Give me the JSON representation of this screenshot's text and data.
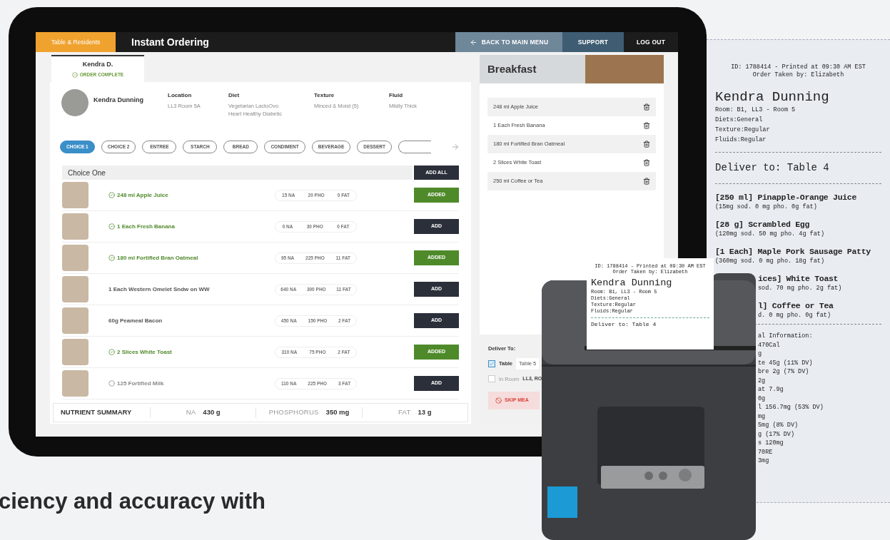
{
  "app": {
    "section_tab": "Table & Residents",
    "title": "Instant Ordering",
    "nav": [
      {
        "label": "BACK TO MAIN MENU",
        "kind": "back"
      },
      {
        "label": "SUPPORT",
        "kind": "support"
      },
      {
        "label": "LOG OUT",
        "kind": "logout"
      }
    ]
  },
  "resident_tab": {
    "name": "Kendra D.",
    "status": "ORDER COMPLETE"
  },
  "resident": {
    "name": "Kendra Dunning",
    "fields": [
      {
        "label": "Location",
        "values": [
          "LL3 Room 5A"
        ]
      },
      {
        "label": "Diet",
        "values": [
          "Vegetarian LactoOvo",
          "Heart Healthy Diabetic"
        ]
      },
      {
        "label": "Texture",
        "values": [
          "Minced & Moist (5)"
        ]
      },
      {
        "label": "Fluid",
        "values": [
          "Mildly Thick"
        ]
      }
    ]
  },
  "chips": [
    {
      "label": "CHOICE 1",
      "selected": true
    },
    {
      "label": "CHOICE 2",
      "selected": false
    },
    {
      "label": "ENTREE",
      "selected": false
    },
    {
      "label": "STARCH",
      "selected": false
    },
    {
      "label": "BREAD",
      "selected": false
    },
    {
      "label": "CONDIMENT",
      "selected": false
    },
    {
      "label": "BEVERAGE",
      "selected": false
    },
    {
      "label": "DESSERT",
      "selected": false
    }
  ],
  "choice": {
    "title": "Choice One",
    "add_all": "ADD ALL",
    "rows": [
      {
        "name": "248 ml Apple Juice",
        "kind": "checked",
        "nutrients": [
          "15 NA",
          "20 PHO",
          "0 FAT"
        ],
        "button": "ADDED",
        "added": true
      },
      {
        "name": "1 Each Fresh Banana",
        "kind": "checked",
        "nutrients": [
          "0 NA",
          "30 PHO",
          "0 FAT"
        ],
        "button": "ADD",
        "added": false
      },
      {
        "name": "180 ml Fortified Bran Oatmeal",
        "kind": "checked",
        "nutrients": [
          "95 NA",
          "225 PHO",
          "11 FAT"
        ],
        "button": "ADDED",
        "added": true
      },
      {
        "name": "1 Each Western Omelet Sndw on WW",
        "kind": "plain",
        "nutrients": [
          "640 NA",
          "300 PHO",
          "11 FAT"
        ],
        "button": "ADD",
        "added": false
      },
      {
        "name": "60g Peameal Bacon",
        "kind": "plain",
        "nutrients": [
          "450 NA",
          "150 PHO",
          "2 FAT"
        ],
        "button": "ADD",
        "added": false
      },
      {
        "name": "2 Slices White Toast",
        "kind": "checked",
        "nutrients": [
          "310 NA",
          "75 PHO",
          "2 FAT"
        ],
        "button": "ADDED",
        "added": true
      },
      {
        "name": "125 Fortified Milk",
        "kind": "pending",
        "nutrients": [
          "110 NA",
          "225 PHO",
          "3 FAT"
        ],
        "button": "ADD",
        "added": false
      }
    ]
  },
  "summary": {
    "title": "NUTRIENT SUMMARY",
    "items": [
      {
        "label": "NA",
        "value": "430 g"
      },
      {
        "label": "PHOSPHORUS",
        "value": "350 mg"
      },
      {
        "label": "FAT",
        "value": "13 g"
      }
    ]
  },
  "order": {
    "title": "Breakfast",
    "items": [
      "248 ml Apple Juice",
      "1 Each Fresh Banana",
      "180 ml Fortified Bran Oatmeal",
      "2 Slices White Toast",
      "250 ml Coffee or Tea"
    ]
  },
  "delivery": {
    "title": "Deliver To:",
    "options": [
      {
        "label": "Table",
        "checked": true,
        "value": "Table 5",
        "kind": "field"
      },
      {
        "label": "In Room",
        "checked": false,
        "value": "LL3, RO",
        "kind": "text"
      }
    ],
    "skip": "SKIP MEA"
  },
  "printer_paper": {
    "header": [
      "ID: 1788414 - Printed at 09:30 AM EST",
      "Order Taken by: Elizabeth"
    ],
    "name": "Kendra Dunning",
    "details": [
      "Room: B1, LL3 - Room 5",
      "Diets:General",
      "Texture:Regular",
      "Fluids:Regular"
    ],
    "deliver": "Deliver to: Table 4"
  },
  "receipt": {
    "header": [
      "ID: 1788414 - Printed at 09:30 AM EST",
      "Order Taken by: Elizabeth"
    ],
    "name": "Kendra Dunning",
    "details": [
      "Room: B1, LL3 - Room 5",
      "Diets:General",
      "Texture:Regular",
      "Fluids:Regular"
    ],
    "deliver": "Deliver to: Table 4",
    "items": [
      {
        "title": "[250 ml] Pinapple-Orange Juice",
        "nutrients": "(15mg sod. 0 mg pho. 0g fat)",
        "clipped": false
      },
      {
        "title": "[28 g] Scrambled Egg",
        "nutrients": "(120mg sod. 50 mg pho. 4g fat)",
        "clipped": false
      },
      {
        "title": "[1 Each] Maple Pork Sausage Patty",
        "nutrients": "(360mg sod. 0 mg pho. 18g fat)",
        "clipped": false
      },
      {
        "title": "ices] White Toast",
        "nutrients": "sod. 70 mg pho. 2g fat)",
        "clipped": true
      },
      {
        "title": "l] Coffee or Tea",
        "nutrients": "d. 0 mg pho. 0g fat)",
        "clipped": true
      }
    ],
    "nutrition": [
      "al Information:",
      "470Cal",
      "g",
      "te 45g (11% DV)",
      "bre 2g (7% DV)",
      "2g",
      "at 7.9g",
      "0g",
      "l 156.7mg (53% DV)",
      "mg",
      "5mg (8% DV)",
      "g (17% DV)",
      "s 120mg",
      "70RE",
      "3mg"
    ]
  },
  "tagline": "ciency and accuracy with"
}
